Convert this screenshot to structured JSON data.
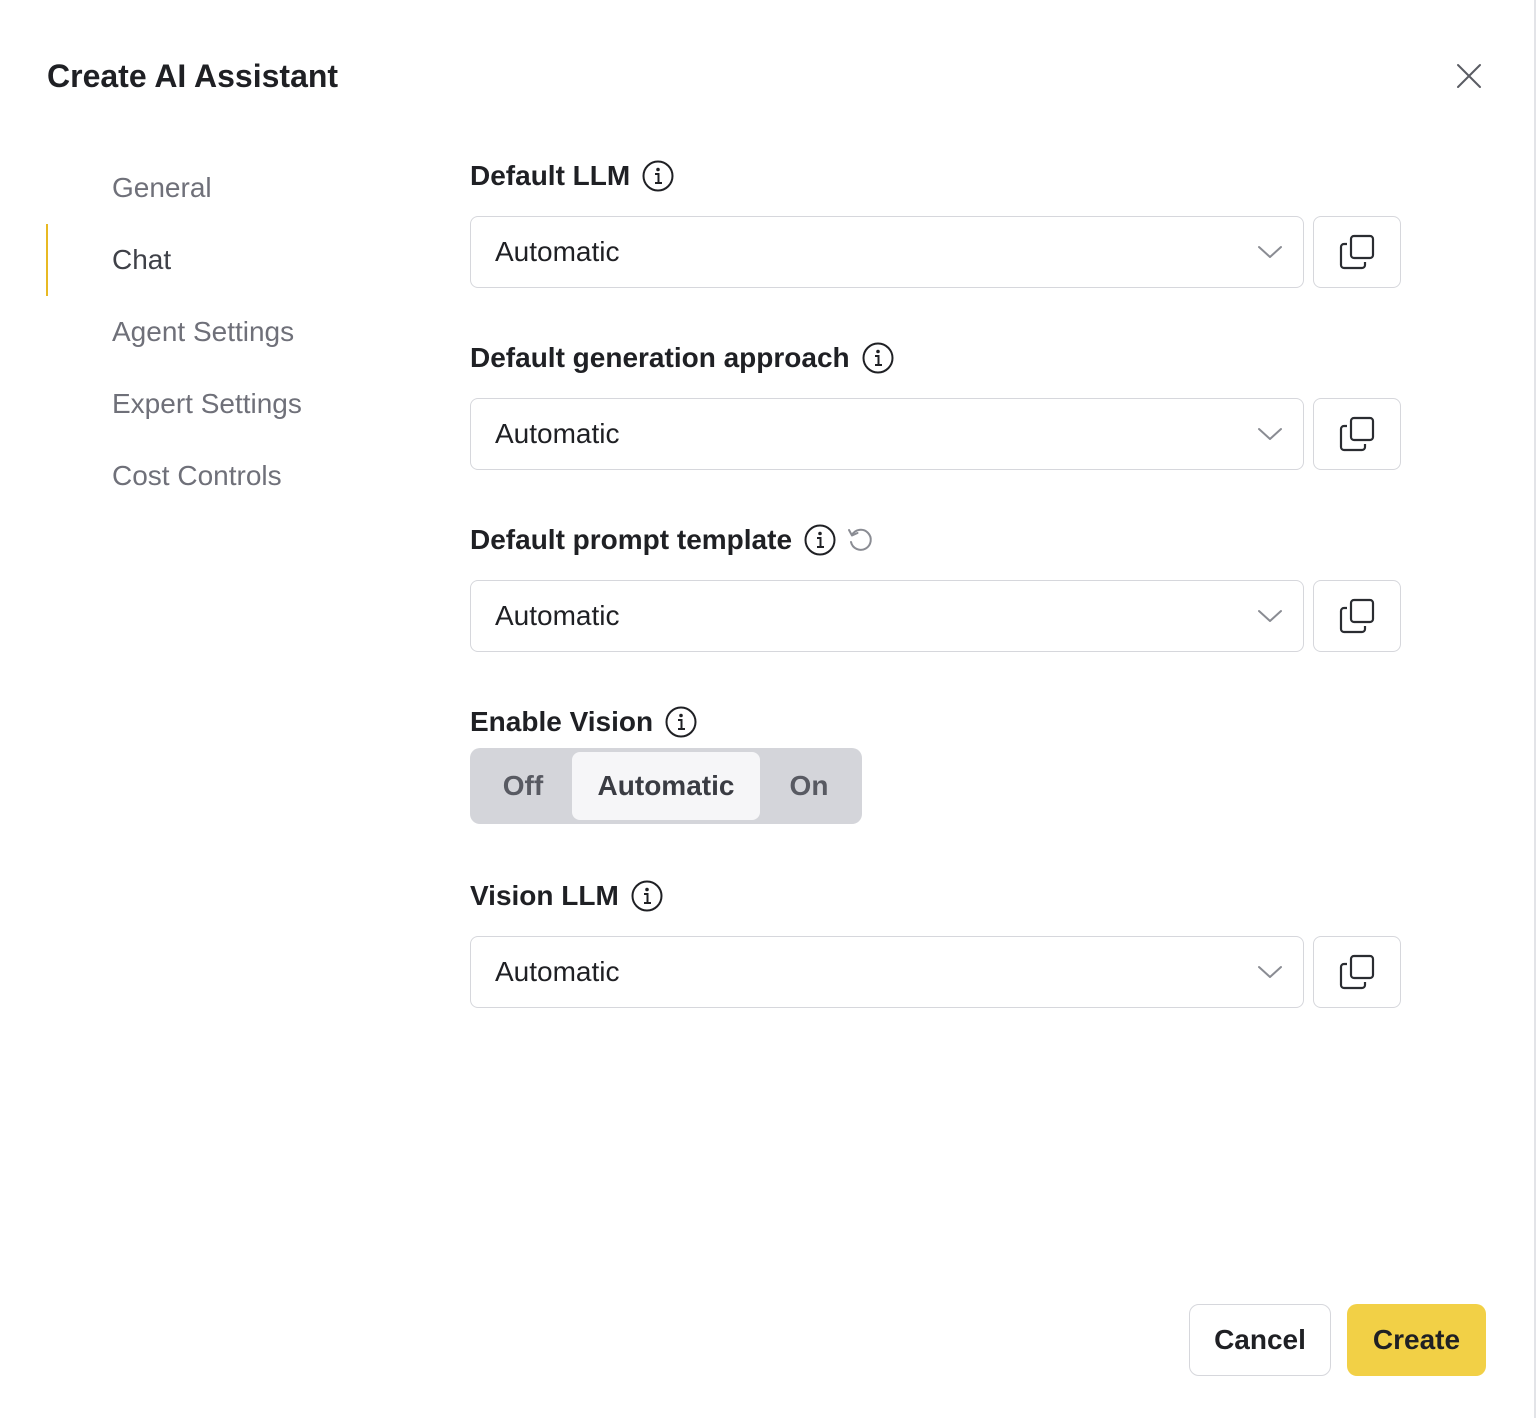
{
  "dialog": {
    "title": "Create AI Assistant",
    "close_icon": "close-icon"
  },
  "sidebar": {
    "items": [
      {
        "label": "General",
        "active": false
      },
      {
        "label": "Chat",
        "active": true
      },
      {
        "label": "Agent Settings",
        "active": false
      },
      {
        "label": "Expert Settings",
        "active": false
      },
      {
        "label": "Cost Controls",
        "active": false
      }
    ],
    "active_indicator_color": "#e8b923"
  },
  "form": {
    "default_llm": {
      "label": "Default LLM",
      "value": "Automatic"
    },
    "generation_approach": {
      "label": "Default generation approach",
      "value": "Automatic"
    },
    "prompt_template": {
      "label": "Default prompt template",
      "value": "Automatic"
    },
    "enable_vision": {
      "label": "Enable Vision",
      "options": [
        "Off",
        "Automatic",
        "On"
      ],
      "selected": "Automatic"
    },
    "vision_llm": {
      "label": "Vision LLM",
      "value": "Automatic"
    }
  },
  "footer": {
    "cancel_label": "Cancel",
    "create_label": "Create",
    "create_color": "#f2d046"
  }
}
